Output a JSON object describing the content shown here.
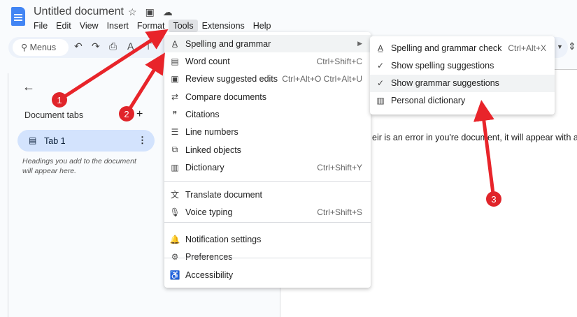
{
  "header": {
    "title": "Untitled document",
    "icons": [
      "star-icon",
      "folder-move-icon",
      "cloud-icon"
    ],
    "menus": [
      "File",
      "Edit",
      "View",
      "Insert",
      "Format",
      "Tools",
      "Extensions",
      "Help"
    ],
    "active_menu": "Tools"
  },
  "toolbar": {
    "search_placeholder": "Menus"
  },
  "sidebar": {
    "section": "Document tabs",
    "tab": "Tab 1",
    "hint": "Headings you add to the document will appear here."
  },
  "document": {
    "text": "eir is an error in you're document, it will appear with a squ"
  },
  "tools_menu": [
    {
      "label": "Spelling and grammar",
      "icon": "spellcheck-icon",
      "shortcut": "",
      "submenu": true
    },
    {
      "label": "Word count",
      "icon": "word-count-icon",
      "shortcut": "Ctrl+Shift+C"
    },
    {
      "label": "Review suggested edits",
      "icon": "review-icon",
      "shortcut": "Ctrl+Alt+O Ctrl+Alt+U"
    },
    {
      "label": "Compare documents",
      "icon": "compare-icon",
      "shortcut": ""
    },
    {
      "label": "Citations",
      "icon": "quote-icon",
      "shortcut": ""
    },
    {
      "label": "Line numbers",
      "icon": "line-numbers-icon",
      "shortcut": ""
    },
    {
      "label": "Linked objects",
      "icon": "link-icon",
      "shortcut": ""
    },
    {
      "label": "Dictionary",
      "icon": "dictionary-icon",
      "shortcut": "Ctrl+Shift+Y"
    },
    {
      "label": "Translate document",
      "icon": "translate-icon",
      "shortcut": ""
    },
    {
      "label": "Voice typing",
      "icon": "mic-icon",
      "shortcut": "Ctrl+Shift+S"
    },
    {
      "label": "Notification settings",
      "icon": "bell-icon",
      "shortcut": ""
    },
    {
      "label": "Preferences",
      "icon": "preferences-icon",
      "shortcut": ""
    },
    {
      "label": "Accessibility",
      "icon": "accessibility-icon",
      "shortcut": ""
    }
  ],
  "submenu": [
    {
      "label": "Spelling and grammar check",
      "icon": "spellcheck-icon",
      "shortcut": "Ctrl+Alt+X"
    },
    {
      "label": "Show spelling suggestions",
      "icon": "check-icon",
      "shortcut": ""
    },
    {
      "label": "Show grammar suggestions",
      "icon": "check-icon",
      "shortcut": ""
    },
    {
      "label": "Personal dictionary",
      "icon": "dictionary-icon",
      "shortcut": ""
    }
  ],
  "annotations": [
    "1",
    "2",
    "3"
  ],
  "accent": "#e8242a"
}
